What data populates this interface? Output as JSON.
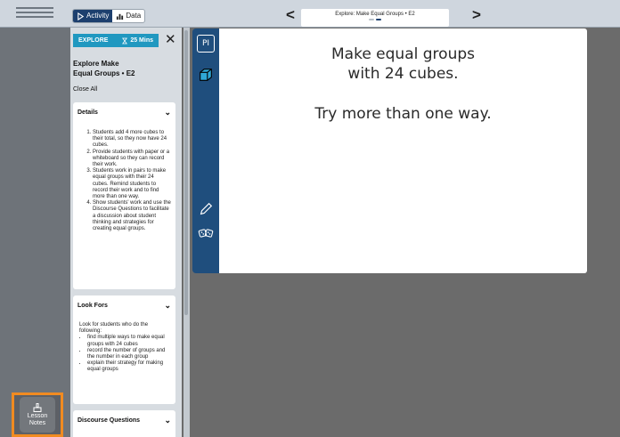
{
  "topbar": {
    "activity_label": "Activity",
    "data_label": "Data",
    "slide_title": "Explore: Make Equal Groups • E2",
    "prev_glyph": "<",
    "next_glyph": ">"
  },
  "panel": {
    "badge_label": "EXPLORE",
    "time_label": "25 Mins",
    "close_glyph": "✕",
    "title_line1": "Explore Make",
    "title_line2": "Equal Groups • E2",
    "close_all": "Close All",
    "details": {
      "heading": "Details",
      "items": [
        "Students add 4 more cubes to their total, so they now have 24 cubes.",
        "Provide students with paper or a whiteboard so they can record their work.",
        "Students work in pairs to make equal groups with their 24 cubes. Remind students to record their work and to find more than one way.",
        "Show students' work and use the Discourse Questions to facilitate a discussion about student thinking and strategies for creating equal groups."
      ]
    },
    "look_fors": {
      "heading": "Look Fors",
      "intro": "Look for students who do the following:",
      "items": [
        "find multiple ways to make equal groups with 24 cubes",
        "record the number of groups and the number in each group",
        "explain their strategy for making equal groups"
      ]
    },
    "discourse": {
      "heading": "Discourse Questions"
    }
  },
  "rail": {
    "lesson_notes_line1": "Lesson",
    "lesson_notes_line2": "Notes"
  },
  "tools": {
    "pi_label": "PI"
  },
  "slide": {
    "line1": "Make equal groups",
    "line2": "with 24 cubes.",
    "line3": "Try more than one way."
  },
  "colors": {
    "accent": "#2098c0",
    "toolstrip": "#1f4e7d",
    "highlight": "#f18b21"
  }
}
